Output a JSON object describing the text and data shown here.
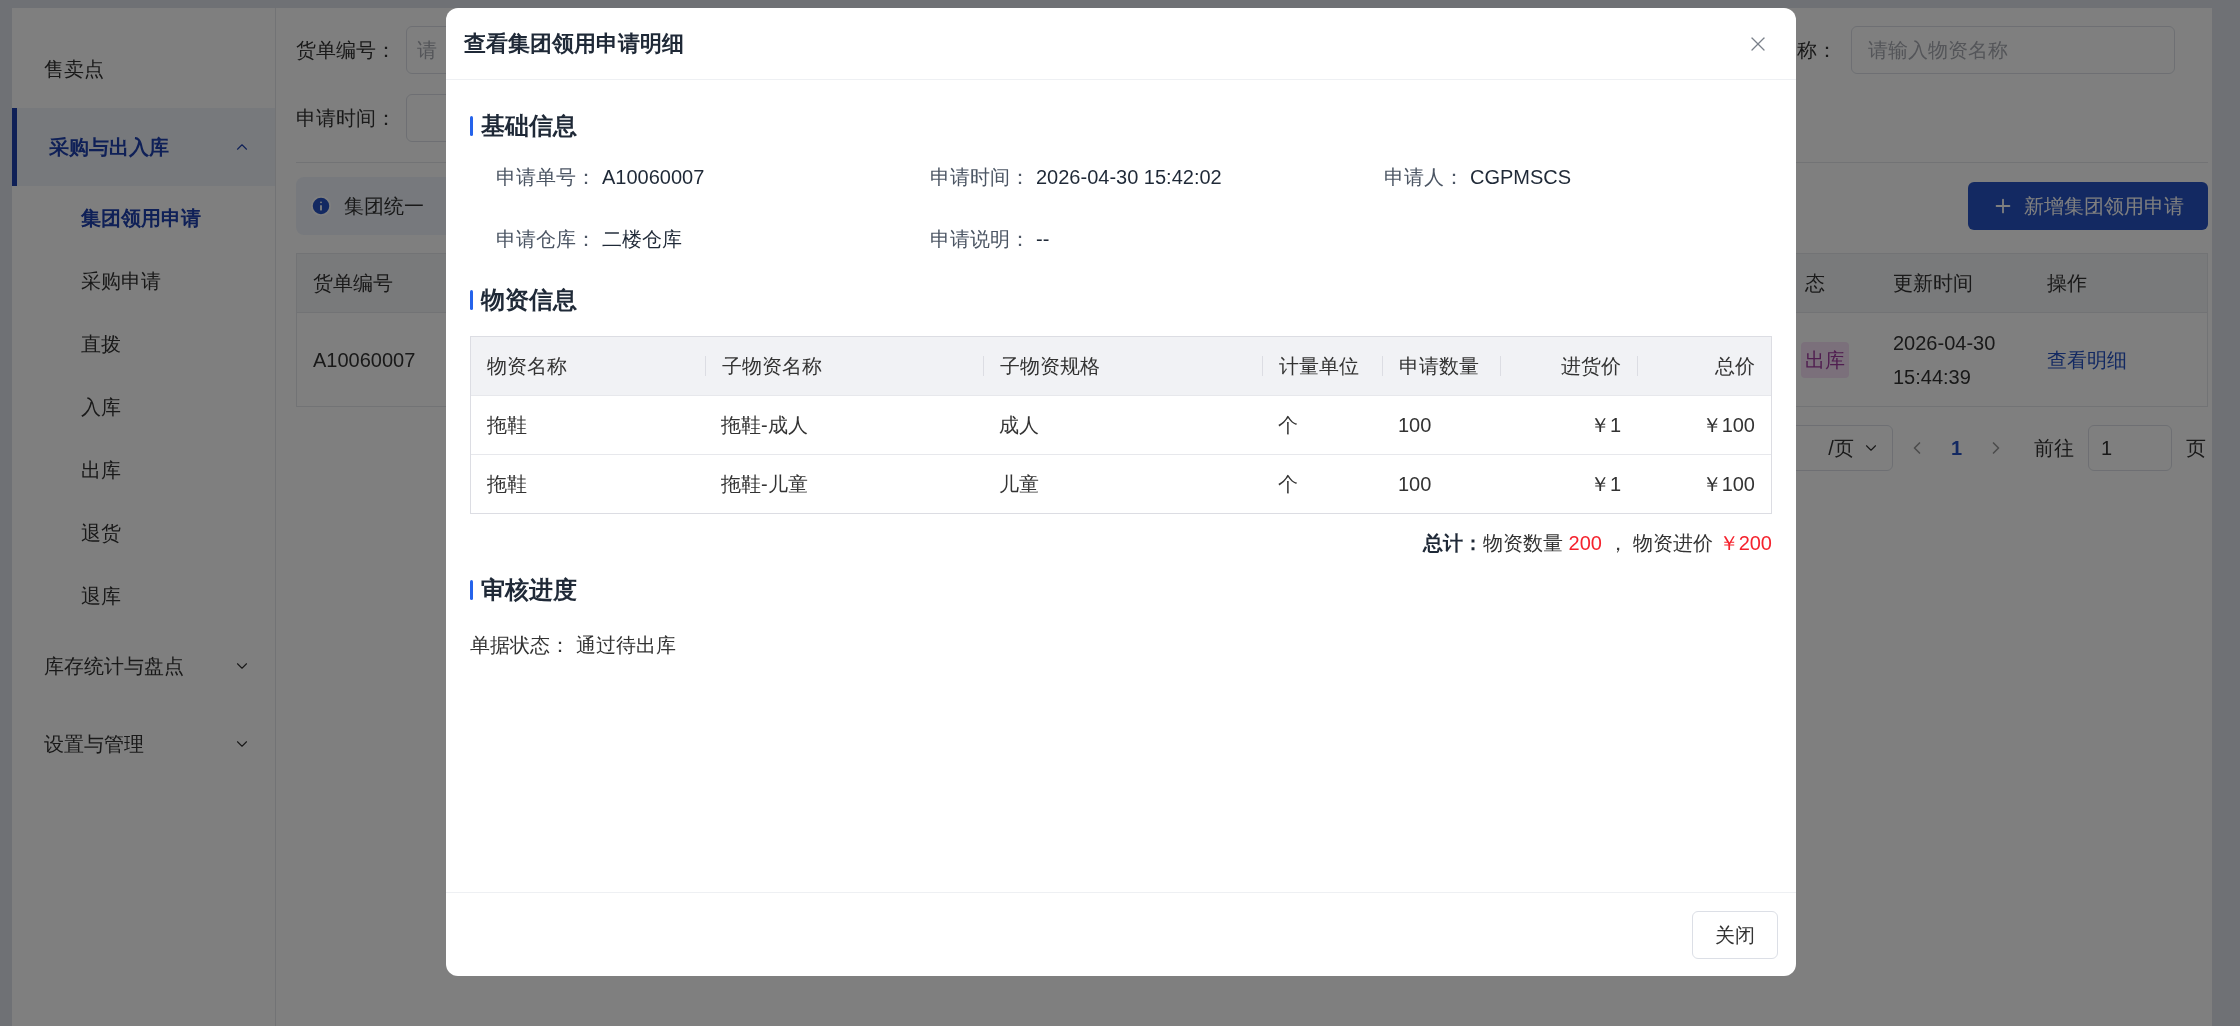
{
  "sidebar": {
    "items": [
      {
        "kind": "item",
        "label": "售卖点",
        "selected": false
      },
      {
        "kind": "group",
        "label": "采购与出入库",
        "selected": true,
        "expanded": true,
        "children": [
          {
            "label": "集团领用申请",
            "selected": true
          },
          {
            "label": "采购申请",
            "selected": false
          },
          {
            "label": "直拨",
            "selected": false
          },
          {
            "label": "入库",
            "selected": false
          },
          {
            "label": "出库",
            "selected": false
          },
          {
            "label": "退货",
            "selected": false
          },
          {
            "label": "退库",
            "selected": false
          }
        ]
      },
      {
        "kind": "group",
        "label": "库存统计与盘点",
        "selected": false,
        "expanded": false
      },
      {
        "kind": "group",
        "label": "设置与管理",
        "selected": false,
        "expanded": false
      }
    ]
  },
  "filters": [
    {
      "label": "货单编号：",
      "placeholder": "请"
    },
    {
      "label": "申请时间："
    }
  ],
  "name_filter": {
    "label": "称：",
    "placeholder": "请输入物资名称"
  },
  "alert": {
    "text": "集团统一"
  },
  "add_button": {
    "label": "新增集团领用申请"
  },
  "table": {
    "columns": [
      "货单编号",
      "态",
      "更新时间",
      "操作"
    ],
    "rows": [
      {
        "order_no": "A10060007",
        "status": "出库",
        "updated": "2026-04-30 15:44:39",
        "action": "查看明细"
      }
    ]
  },
  "pagination": {
    "page_size": "/页",
    "pages": [
      {
        "label": "1",
        "selected": true
      }
    ],
    "goto_label": "前往",
    "goto_value": "1",
    "page_suffix": "页"
  },
  "dialog": {
    "title": "查看集团领用申请明细",
    "basic": {
      "heading": "基础信息",
      "rows": [
        [
          {
            "label": "申请单号：",
            "value": "A10060007"
          },
          {
            "label": "申请时间：",
            "value": "2026-04-30 15:42:02"
          },
          {
            "label": "申请人：",
            "value": "CGPMSCS"
          }
        ],
        [
          {
            "label": "申请仓库：",
            "value": "二楼仓库"
          },
          {
            "label": "申请说明：",
            "value": "--"
          }
        ]
      ]
    },
    "materials": {
      "heading": "物资信息",
      "columns": [
        "物资名称",
        "子物资名称",
        "子物资规格",
        "计量单位",
        "申请数量",
        "进货价",
        "总价"
      ],
      "rows": [
        [
          "拖鞋",
          "拖鞋-成人",
          "成人",
          "个",
          "100",
          "￥1",
          "￥100"
        ],
        [
          "拖鞋",
          "拖鞋-儿童",
          "儿童",
          "个",
          "100",
          "￥1",
          "￥100"
        ]
      ],
      "total": {
        "label": "总计：",
        "qty_label": "物资数量",
        "qty": "200",
        "separator": "，",
        "price_label": "物资进价",
        "price": "￥200"
      }
    },
    "review": {
      "heading": "审核进度",
      "status_label": "单据状态：",
      "status": "通过待出库"
    },
    "close_button": "关闭"
  }
}
